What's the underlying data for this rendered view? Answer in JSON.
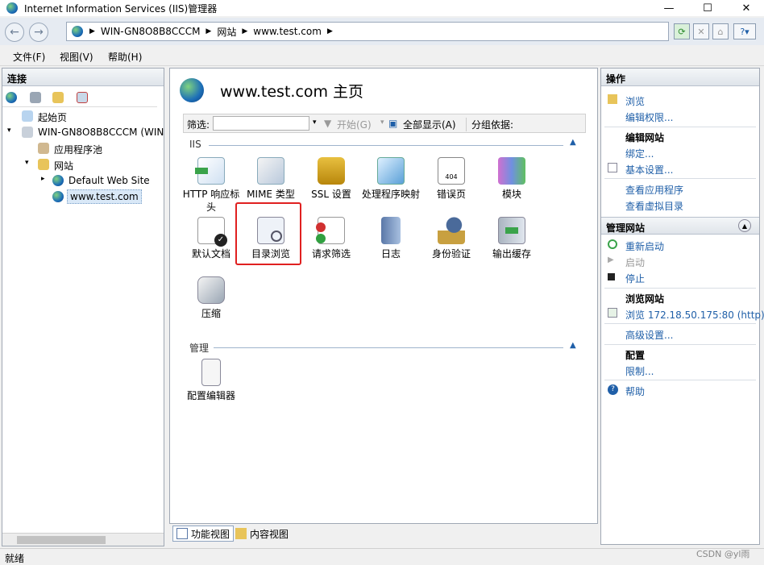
{
  "window": {
    "title": "Internet Information Services (IIS)管理器"
  },
  "address": {
    "crumbs": [
      "WIN-GN8O8B8CCCM",
      "网站",
      "www.test.com"
    ]
  },
  "menu": [
    "文件(F)",
    "视图(V)",
    "帮助(H)"
  ],
  "connections": {
    "header": "连接",
    "tree": [
      "起始页",
      "WIN-GN8O8B8CCCM (WIN",
      "应用程序池",
      "网站",
      "Default Web Site",
      "www.test.com"
    ]
  },
  "main": {
    "title": "www.test.com 主页",
    "filter": {
      "label": "筛选:",
      "start": "开始(G)",
      "showall": "全部显示(A)",
      "groupby": "分组依据:"
    },
    "sections": {
      "iis": "IIS",
      "manage": "管理"
    },
    "features": [
      "HTTP 响应标头",
      "MIME 类型",
      "SSL 设置",
      "处理程序映射",
      "错误页",
      "模块",
      "默认文档",
      "目录浏览",
      "请求筛选",
      "日志",
      "身份验证",
      "输出缓存",
      "压缩"
    ],
    "manage_features": [
      "配置编辑器"
    ],
    "views": {
      "feature": "功能视图",
      "content": "内容视图"
    }
  },
  "actions": {
    "header": "操作",
    "browse": "浏览",
    "editperm": "编辑权限...",
    "editsite": "编辑网站",
    "bind": "绑定...",
    "basic": "基本设置...",
    "viewapps": "查看应用程序",
    "viewvdir": "查看虚拟目录",
    "manage_header": "管理网站",
    "restart": "重新启动",
    "start": "启动",
    "stop": "停止",
    "browse_site": "浏览网站",
    "browse_url": "浏览 172.18.50.175:80 (http)",
    "advanced": "高级设置...",
    "config": "配置",
    "limits": "限制...",
    "help": "帮助"
  },
  "status": {
    "text": "就绪",
    "watermark": "CSDN @yl雨"
  },
  "colors": {
    "accent": "#1f5fa8",
    "highlight": "#e02020"
  }
}
